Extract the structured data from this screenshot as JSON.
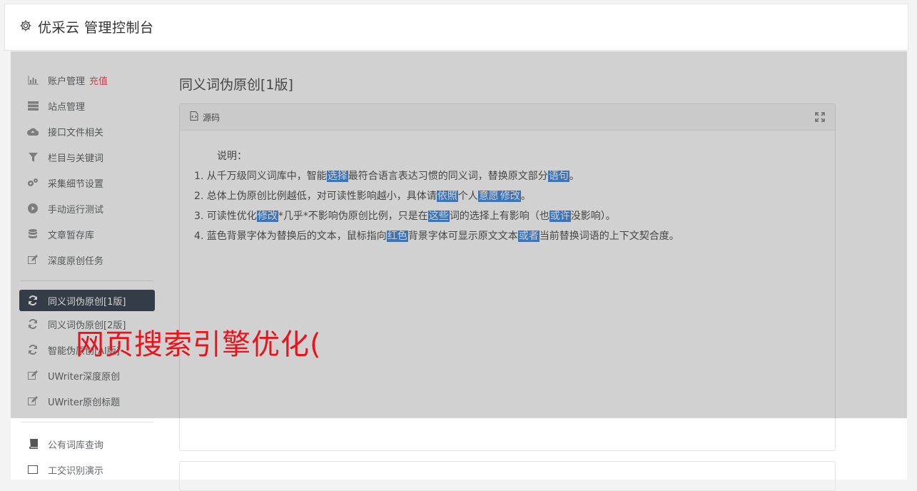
{
  "header": {
    "title": "优采云 管理控制台",
    "icon": "gear-icon"
  },
  "sidebar": {
    "group1": [
      {
        "label": "账户管理",
        "extra": "充值",
        "icon": "bar-chart-icon"
      },
      {
        "label": "站点管理",
        "icon": "server-icon"
      },
      {
        "label": "接口文件相关",
        "icon": "cloud-upload-icon"
      },
      {
        "label": "栏目与关键词",
        "icon": "filter-icon"
      },
      {
        "label": "采集细节设置",
        "icon": "cogs-icon"
      },
      {
        "label": "手动运行测试",
        "icon": "play-circle-icon"
      },
      {
        "label": "文章暂存库",
        "icon": "database-icon"
      },
      {
        "label": "深度原创任务",
        "icon": "edit-icon"
      }
    ],
    "group2": [
      {
        "label": "同义词伪原创[1版]",
        "icon": "refresh-icon",
        "active": true
      },
      {
        "label": "同义词伪原创[2版]",
        "icon": "refresh-icon"
      },
      {
        "label": "智能伪原创[AI版]",
        "icon": "refresh-icon"
      },
      {
        "label": "UWriter深度原创",
        "icon": "edit-icon"
      },
      {
        "label": "UWriter原创标题",
        "icon": "edit-icon"
      }
    ],
    "group3": [
      {
        "label": "公有词库查询",
        "icon": "book-icon"
      },
      {
        "label": "工交识别演示",
        "icon": "square-icon"
      }
    ]
  },
  "main": {
    "title": "同义词伪原创[1版]",
    "panel_title": "源码",
    "intro": "说明：",
    "lines": [
      [
        "1. 从千万级同义词库中，智能",
        {
          "hl": "选择"
        },
        "最符合语言表达习惯的同义词，替换原文部分",
        {
          "hl": "语句"
        },
        "。"
      ],
      [
        "2. 总体上伪原创比例越低，对可读性影响越小，具体请",
        {
          "hl": "依照"
        },
        "个人",
        {
          "hl": "意愿"
        },
        {
          "hl": "修改"
        },
        "。"
      ],
      [
        "3. 可读性优化",
        {
          "hl": "修改"
        },
        "*几乎*不影响伪原创比例，只是在",
        {
          "hl": "这些"
        },
        "词的选择上有影响（也",
        {
          "hl": "或许"
        },
        "没影响）。"
      ],
      [
        "4. 蓝色背景字体为替换后的文本，鼠标指向",
        {
          "hl": "红色"
        },
        "背景字体可显示原文文本",
        {
          "hl": "或者"
        },
        "当前替换词语的上下文契合度。"
      ]
    ]
  },
  "watermark": "网页搜索引擎优化(",
  "colors": {
    "active_bg": "#3f4a57",
    "highlight": "#4b8ede",
    "watermark": "#e8141b",
    "badge": "#ed5565"
  }
}
